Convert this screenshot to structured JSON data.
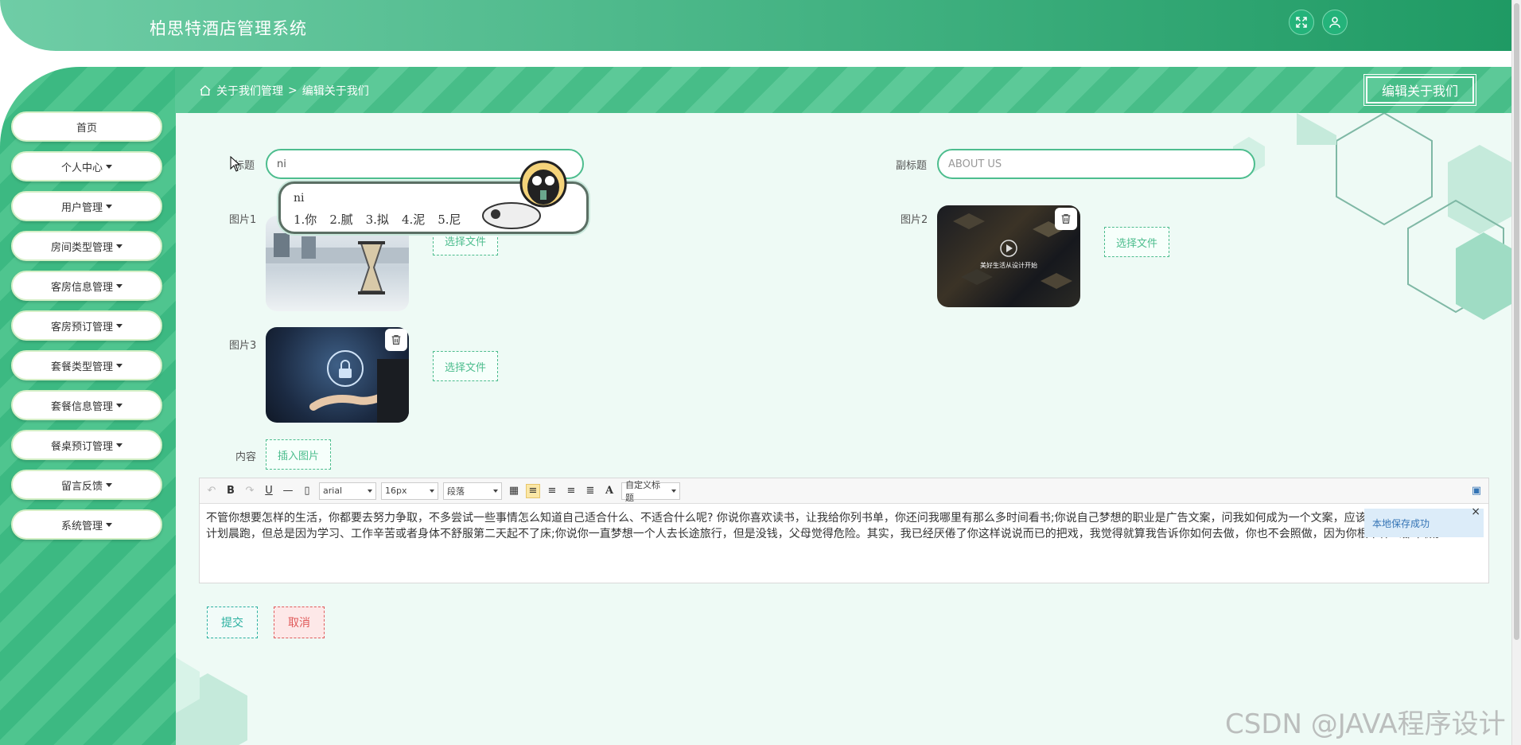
{
  "header": {
    "title": "柏思特酒店管理系统"
  },
  "breadcrumb": {
    "parent": "关于我们管理",
    "separator": ">",
    "current": "编辑关于我们"
  },
  "top_action": {
    "label": "编辑关于我们"
  },
  "sidebar": {
    "items": [
      {
        "label": "首页",
        "has_dropdown": false
      },
      {
        "label": "个人中心",
        "has_dropdown": true
      },
      {
        "label": "用户管理",
        "has_dropdown": true
      },
      {
        "label": "房间类型管理",
        "has_dropdown": true
      },
      {
        "label": "客房信息管理",
        "has_dropdown": true
      },
      {
        "label": "客房预订管理",
        "has_dropdown": true
      },
      {
        "label": "套餐类型管理",
        "has_dropdown": true
      },
      {
        "label": "套餐信息管理",
        "has_dropdown": true
      },
      {
        "label": "餐桌预订管理",
        "has_dropdown": true
      },
      {
        "label": "留言反馈",
        "has_dropdown": true
      },
      {
        "label": "系统管理",
        "has_dropdown": true
      }
    ]
  },
  "form": {
    "title_label": "标题",
    "title_value": "ni",
    "subtitle_label": "副标题",
    "subtitle_value": "ABOUT US",
    "image1_label": "图片1",
    "image2_label": "图片2",
    "image3_label": "图片3",
    "choose_file": "选择文件",
    "image2_caption": "美好生活从设计开始",
    "content_label": "内容",
    "insert_image": "插入图片"
  },
  "ime": {
    "pinyin": "ni",
    "candidates": [
      "1.你",
      "2.腻",
      "3.拟",
      "4.泥",
      "5.尼"
    ]
  },
  "editor": {
    "font_family": "arial",
    "font_size": "16px",
    "paragraph": "段落",
    "custom_heading": "自定义标题",
    "content": "不管你想要怎样的生活，你都要去努力争取，不多尝试一些事情怎么知道自己适合什么、不适合什么呢? 你说你喜欢读书，让我给你列书单，你还问我哪里有那么多时间看书;你说自己梦想的职业是广告文案，问我如何成为一个文案，应该具备哪些素质;你说你计划晨跑，但总是因为学习、工作辛苦或者身体不舒服第二天起不了床;你说你一直梦想一个人去长途旅行，但是没钱，父母觉得危险。其实，我已经厌倦了你这样说说而已的把戏，我觉得就算我告诉你如何去做，你也不会照做，因为你根本什么都不做。",
    "toast": "本地保存成功",
    "toast_close": "×"
  },
  "actions": {
    "submit": "提交",
    "cancel": "取消"
  },
  "watermark": "CSDN @JAVA程序设计",
  "colors": {
    "primary": "#3cb982",
    "accent": "#4dbd8e",
    "cancel": "#e05a5a",
    "submit": "#2bb0a0"
  }
}
